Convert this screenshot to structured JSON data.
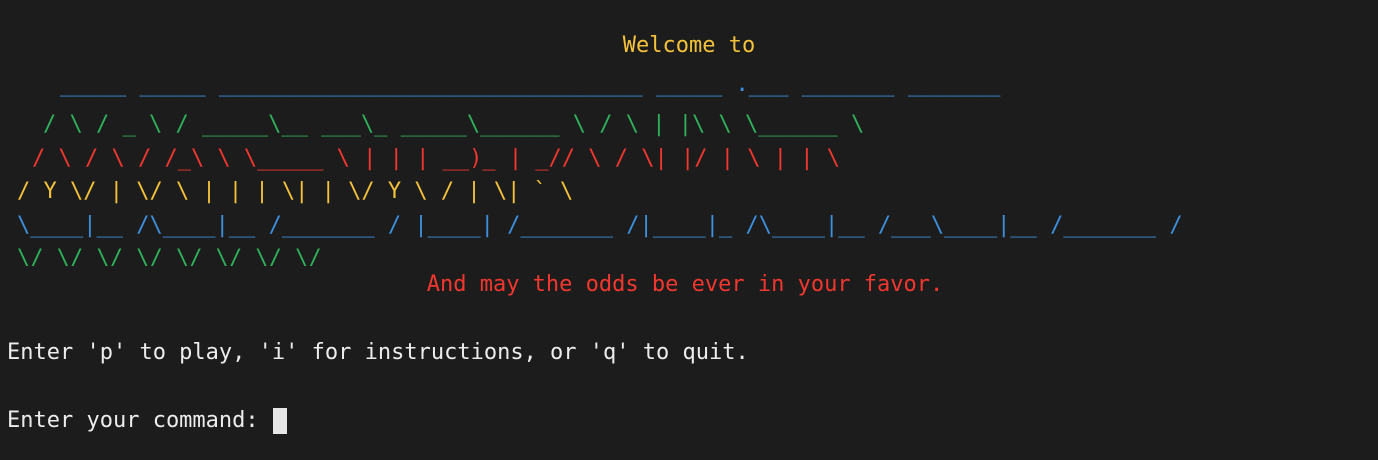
{
  "window": {
    "background": "#1c1c1c"
  },
  "welcome_text": "Welcome to",
  "banner": {
    "lines": [
      {
        "text": "  _____     _____     __________________________________    _____   .___  _______   ________",
        "color": "#3d8fdc"
      },
      {
        "text": " /     \\   /  _  \\   /   ______\\__     ___\\_    ______\\______   \\  /     \\ |   |\\      \\  \\_______  \\",
        "color": "#2fb05a"
      },
      {
        "text": "/  \\ /  \\ /  /_\\  \\  \\_____  \\   |    |   |    __)_  |       _//  \\ /  \\|   |/   |   \\  |       \\",
        "color": "#f2372e"
      },
      {
        "text": "/    Y    \\/    |    \\/        \\  |    |   |        \\ |    |   \\/    Y    \\   |/    |    \\ |    `   \\",
        "color": "#f3c13a"
      },
      {
        "text": "\\____|__  /\\____|__  /_______  /  |____|  /_______  / |____|_  /\\____|__  /___\\____|__  /_______  /",
        "color": "#3d8fdc"
      },
      {
        "text": "        \\/         \\/        \\/                  \\/         \\/         \\/            \\/        \\/",
        "color": "#2fb05a"
      }
    ]
  },
  "tagline": "And may the odds be ever in your favor.",
  "prompt": "Enter 'p' to play, 'i' for instructions, or 'q' to quit.",
  "command_label": "Enter your command:",
  "colors": {
    "yellow": "#f3c13a",
    "red": "#f2372e",
    "blue": "#3d8fdc",
    "green": "#2fb05a",
    "text": "#ececec",
    "cursor": "#e6e6e6"
  }
}
